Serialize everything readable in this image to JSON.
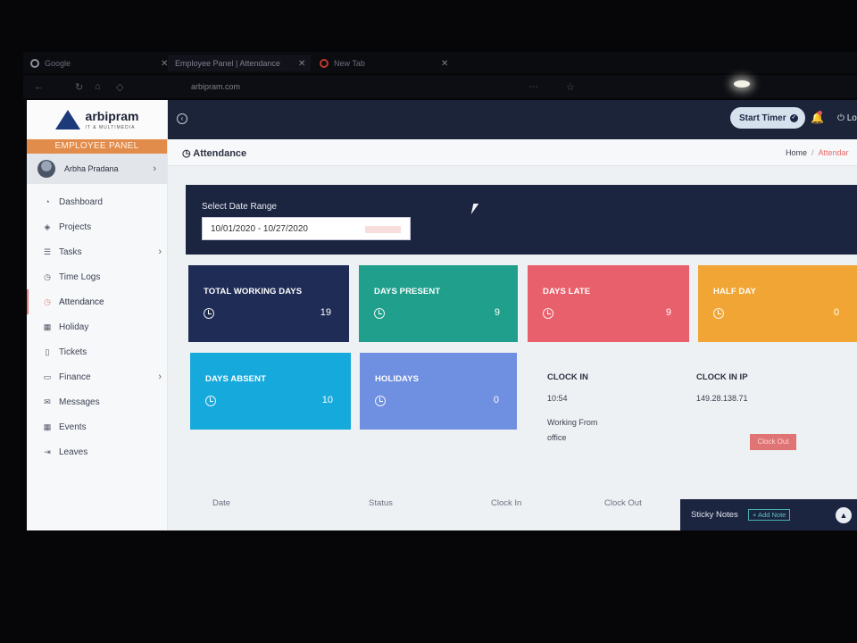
{
  "browser": {
    "tabs": [
      {
        "title": "Google"
      },
      {
        "title": "Employee Panel | Attendance"
      },
      {
        "title": "New Tab"
      }
    ],
    "address": "arbipram.com"
  },
  "brand": {
    "name": "arbipram",
    "tagline": "IT & MULTIMEDIA"
  },
  "sidebar": {
    "panel_label": "EMPLOYEE PANEL",
    "user_name": "Arbha Pradana",
    "items": [
      {
        "label": "Dashboard",
        "icon": "dashboard-icon"
      },
      {
        "label": "Projects",
        "icon": "layers-icon"
      },
      {
        "label": "Tasks",
        "icon": "tasks-icon"
      },
      {
        "label": "Time Logs",
        "icon": "clock-icon"
      },
      {
        "label": "Attendance",
        "icon": "clock-icon"
      },
      {
        "label": "Holiday",
        "icon": "calendar-icon"
      },
      {
        "label": "Tickets",
        "icon": "ticket-icon"
      },
      {
        "label": "Finance",
        "icon": "money-icon"
      },
      {
        "label": "Messages",
        "icon": "envelope-icon"
      },
      {
        "label": "Events",
        "icon": "calendar-icon"
      },
      {
        "label": "Leaves",
        "icon": "sign-out-icon"
      }
    ]
  },
  "topbar": {
    "timer_label": "Start Timer",
    "logout_label": "Lo"
  },
  "page": {
    "title": "Attendance",
    "breadcrumb": {
      "home": "Home",
      "current": "Attendar"
    }
  },
  "filter": {
    "label": "Select Date Range",
    "value": "10/01/2020 - 10/27/2020"
  },
  "stats": [
    {
      "label": "TOTAL WORKING DAYS",
      "value": "19",
      "color": "#1f2d56"
    },
    {
      "label": "DAYS PRESENT",
      "value": "9",
      "color": "#1f9f8c"
    },
    {
      "label": "DAYS LATE",
      "value": "9",
      "color": "#e8606b"
    },
    {
      "label": "HALF DAY",
      "value": "0",
      "color": "#f1a534"
    },
    {
      "label": "DAYS ABSENT",
      "value": "10",
      "color": "#16a9dc"
    },
    {
      "label": "HOLIDAYS",
      "value": "0",
      "color": "#6f8fe0"
    }
  ],
  "clock": {
    "in_label": "CLOCK IN",
    "in_time": "10:54",
    "working_from_label": "Working From",
    "working_from": "office",
    "ip_label": "CLOCK IN IP",
    "ip": "149.28.138.71",
    "clock_out_label": "Clock Out"
  },
  "table": {
    "columns": [
      "Date",
      "Status",
      "Clock In",
      "Clock Out"
    ]
  },
  "sticky": {
    "title": "Sticky Notes",
    "add_label": "+ Add Note"
  }
}
